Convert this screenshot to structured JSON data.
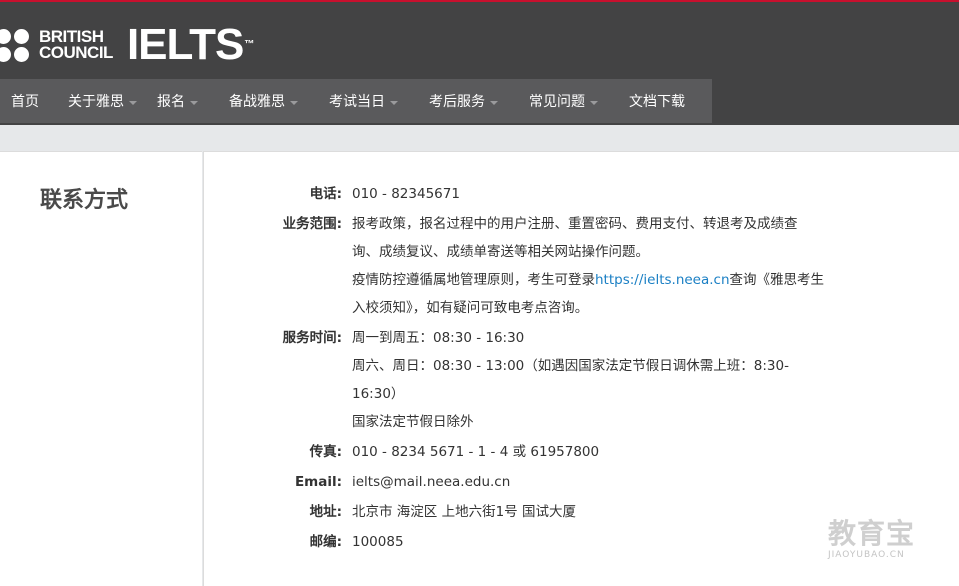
{
  "brand": {
    "bc_line1": "BRITISH",
    "bc_line2": "COUNCIL",
    "ielts": "IELTS",
    "tm": "™"
  },
  "nav": {
    "items": [
      {
        "label": "首页",
        "caret": false
      },
      {
        "label": "关于雅思",
        "caret": true
      },
      {
        "label": "报名",
        "caret": true
      },
      {
        "label": "备战雅思",
        "caret": true
      },
      {
        "label": "考试当日",
        "caret": true
      },
      {
        "label": "考后服务",
        "caret": true
      },
      {
        "label": "常见问题",
        "caret": true
      },
      {
        "label": "文档下载",
        "caret": false
      }
    ]
  },
  "sidebar": {
    "title": "联系方式"
  },
  "contact": {
    "phone_label": "电话:",
    "phone": "010 - 82345671",
    "scope_label": "业务范围:",
    "scope_line1": "报考政策，报名过程中的用户注册、重置密码、费用支付、转退考及成绩查",
    "scope_line2": "询、成绩复议、成绩单寄送等相关网站操作问题。",
    "scope_line3_pre": "疫情防控遵循属地管理原则，考生可登录",
    "scope_link": "https://ielts.neea.cn",
    "scope_line3_post": "查询《雅思考生",
    "scope_line4": "入校须知》，如有疑问可致电考点咨询。",
    "hours_label": "服务时间:",
    "hours_line1": "周一到周五：08:30 - 16:30",
    "hours_line2": "周六、周日：08:30 - 13:00（如遇因国家法定节假日调休需上班：8:30-",
    "hours_line3": "16:30）",
    "hours_line4": "国家法定节假日除外",
    "fax_label": "传真:",
    "fax": "010 - 8234 5671 - 1 - 4 或 61957800",
    "email_label": "Email:",
    "email": "ielts@mail.neea.edu.cn",
    "address_label": "地址:",
    "address": "北京市 海淀区 上地六街1号 国试大厦",
    "zip_label": "邮编:",
    "zip": "100085"
  },
  "watermark": {
    "cn": "教育宝",
    "en": "JIAOYUBAO.CN"
  },
  "colors": {
    "header": "#434344",
    "nav": "#5a5a5c",
    "link": "#1a7fc4",
    "accent": "#c8102e"
  }
}
